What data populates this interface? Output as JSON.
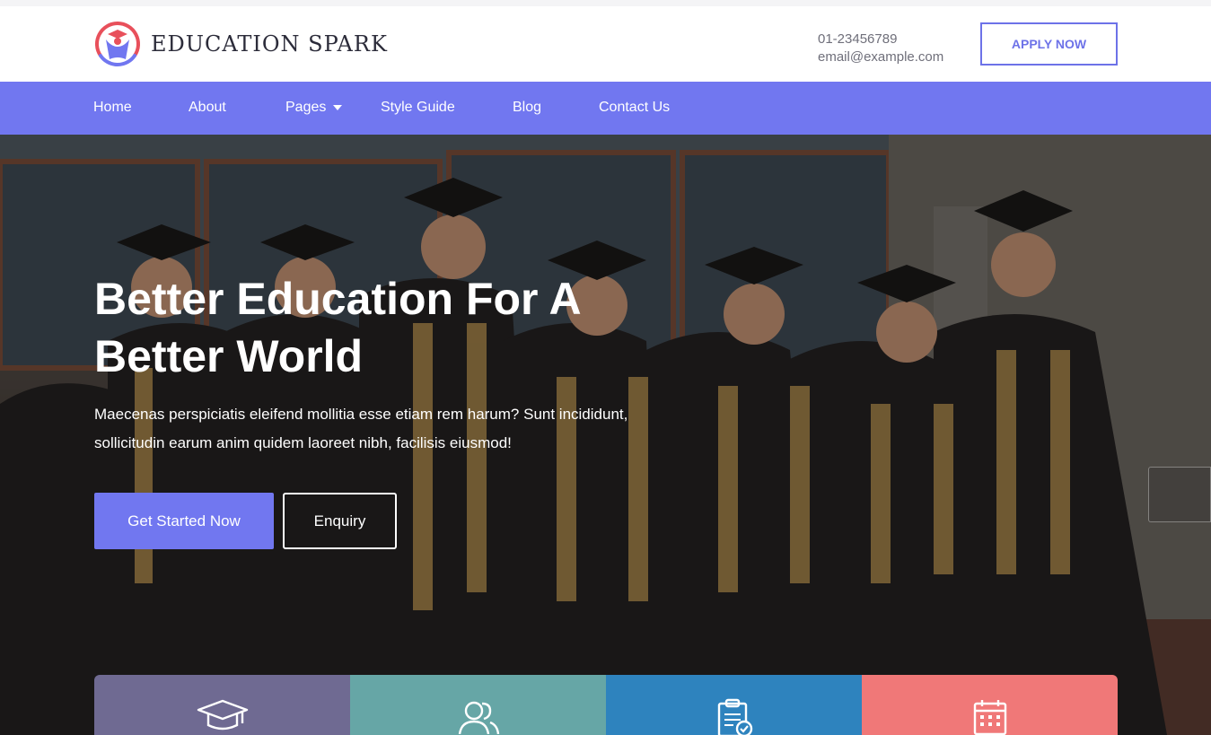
{
  "brand": {
    "name": "EDUCATION SPARK",
    "accent": "#7177f0",
    "logo_colors": [
      "#e8505b",
      "#7177f0"
    ]
  },
  "header": {
    "phone": "01-23456789",
    "email": "email@example.com",
    "apply_label": "APPLY NOW"
  },
  "nav": {
    "items": [
      {
        "label": "Home"
      },
      {
        "label": "About"
      },
      {
        "label": "Pages",
        "has_dropdown": true
      },
      {
        "label": "Style Guide"
      },
      {
        "label": "Blog"
      },
      {
        "label": "Contact Us"
      }
    ]
  },
  "hero": {
    "title": "Better Education For A Better World",
    "description": "Maecenas perspiciatis eleifend mollitia esse etiam rem harum? Sunt incididunt, sollicitudin earum anim quidem laoreet nibh, facilisis eiusmod!",
    "primary_button": "Get Started Now",
    "secondary_button": "Enquiry",
    "image": "graduates-group-photo"
  },
  "features": [
    {
      "icon": "graduation-cap-icon",
      "color": "#6f6a92"
    },
    {
      "icon": "users-icon",
      "color": "#66a6a6"
    },
    {
      "icon": "clipboard-check-icon",
      "color": "#2e83be"
    },
    {
      "icon": "calendar-icon",
      "color": "#f07878"
    }
  ]
}
